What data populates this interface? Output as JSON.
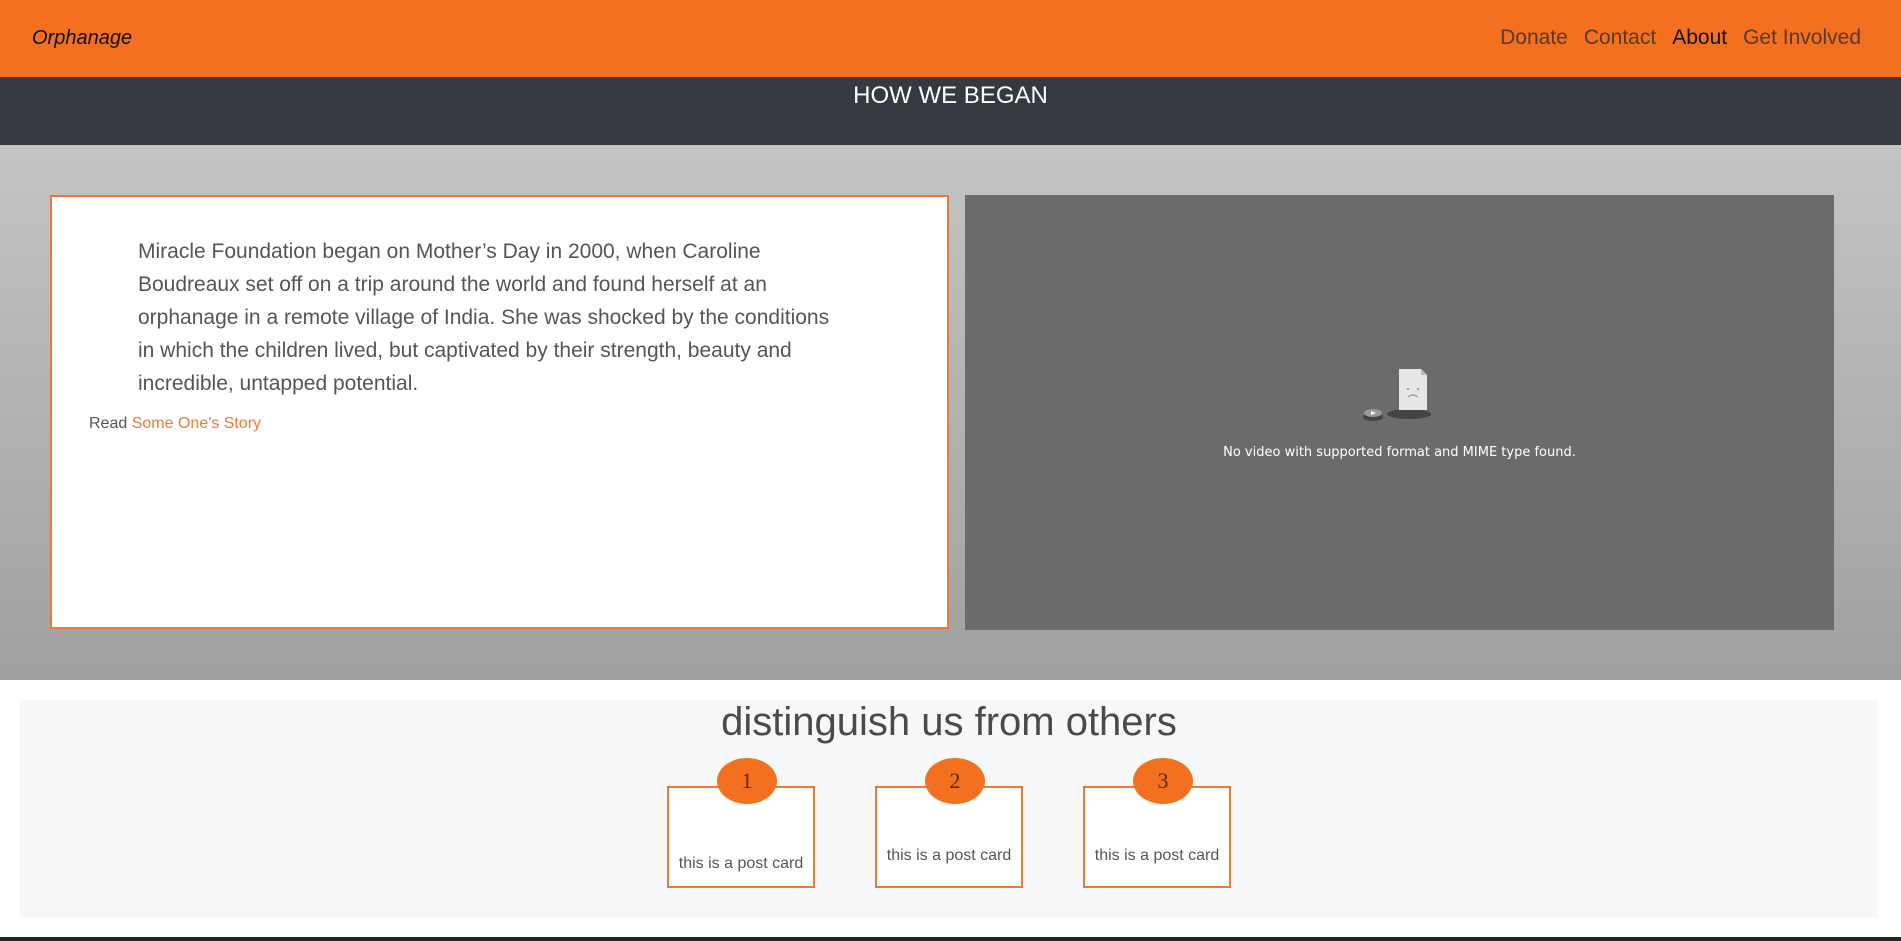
{
  "navbar": {
    "brand": "Orphanage",
    "links": [
      {
        "label": "Donate",
        "active": false
      },
      {
        "label": "Contact",
        "active": false
      },
      {
        "label": "About",
        "active": true
      },
      {
        "label": "Get Involved",
        "active": false
      }
    ]
  },
  "header": {
    "title": "HOW WE BEGAN"
  },
  "story": {
    "text": "Miracle Foundation began on Mother’s Day in 2000, when Caroline Boudreaux set off on a trip around the world and found herself at an orphanage in a remote village of India. She was shocked by the conditions in which the children lived, but captivated by their strength, beauty and incredible, untapped potential.",
    "read_prefix": "Read",
    "read_link": "Some One's Story"
  },
  "video": {
    "message": "No video with supported format and MIME type found."
  },
  "features": {
    "title": "distinguish us from others",
    "cards": [
      {
        "number": "1",
        "text": "this is a post card"
      },
      {
        "number": "2",
        "text": "this is a post card"
      },
      {
        "number": "3",
        "text": "this is a post card"
      }
    ]
  },
  "colors": {
    "brand_orange": "#f37021",
    "header_dark": "#343a40"
  }
}
